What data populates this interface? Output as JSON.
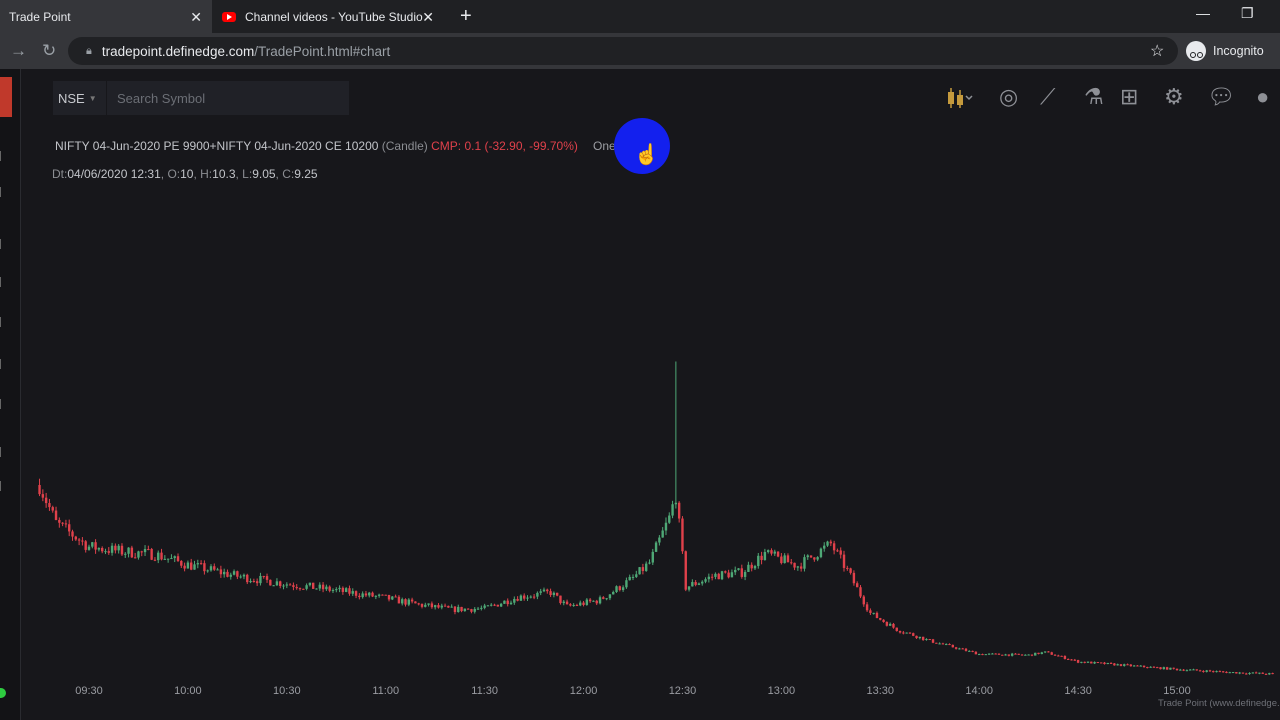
{
  "browser": {
    "tabs": [
      {
        "title": "Trade Point",
        "active": true
      },
      {
        "title": "Channel videos - YouTube Studio",
        "active": false,
        "icon": "youtube-icon"
      }
    ],
    "url_host": "tradepoint.definedge.com",
    "url_path": "/TradePoint.html#chart",
    "profile": "Incognito"
  },
  "app": {
    "exchange": "NSE",
    "search_placeholder": "Search Symbol",
    "toolbar_icons": [
      "candlestick-icon",
      "indicator-icon",
      "drawing-icon",
      "flask-icon",
      "layout-grid-icon",
      "settings-icon",
      "chat-help-icon",
      "user-icon"
    ]
  },
  "chart": {
    "symbol": "NIFTY 04-Jun-2020 PE 9900+NIFTY 04-Jun-2020 CE 10200",
    "chart_type_label": "(Candle)",
    "cmp": "CMP: 0.1 (-32.90, -99.70%)",
    "interval": "One M",
    "ohlc": {
      "dt_label": "Dt:",
      "dt": "04/06/2020 12:31",
      "o_label": "O:",
      "o": "10",
      "h_label": "H:",
      "h": "10.3",
      "l_label": "L:",
      "l": "9.05",
      "c_label": "C:",
      "c": "9.25"
    },
    "credit": "Trade Point (www.definedge.c"
  },
  "colors": {
    "up": "#4ea876",
    "down": "#e0414b",
    "background": "#17171b",
    "cursor_highlight": "#1320ee"
  },
  "chart_data": {
    "type": "candlestick",
    "x_unit": "time (1-minute candles)",
    "x_ticks": [
      "09:30",
      "10:00",
      "10:30",
      "11:00",
      "11:30",
      "12:00",
      "12:30",
      "13:00",
      "13:30",
      "14:00",
      "14:30",
      "15:00"
    ],
    "xlim": [
      "09:15",
      "15:30"
    ],
    "y_axis_shown": false,
    "approx_close_path": [
      {
        "t": "09:15",
        "v": 20
      },
      {
        "t": "09:20",
        "v": 16
      },
      {
        "t": "09:30",
        "v": 13.5
      },
      {
        "t": "09:40",
        "v": 13
      },
      {
        "t": "09:50",
        "v": 12.7
      },
      {
        "t": "10:00",
        "v": 11.6
      },
      {
        "t": "10:15",
        "v": 10.4
      },
      {
        "t": "10:30",
        "v": 9.6
      },
      {
        "t": "10:45",
        "v": 8.9
      },
      {
        "t": "11:00",
        "v": 8.1
      },
      {
        "t": "11:10",
        "v": 7.4
      },
      {
        "t": "11:20",
        "v": 6.9
      },
      {
        "t": "11:30",
        "v": 7.0
      },
      {
        "t": "11:40",
        "v": 8.2
      },
      {
        "t": "11:50",
        "v": 8.7
      },
      {
        "t": "11:55",
        "v": 7.2
      },
      {
        "t": "12:05",
        "v": 7.9
      },
      {
        "t": "12:15",
        "v": 10.2
      },
      {
        "t": "12:20",
        "v": 11.8
      },
      {
        "t": "12:26",
        "v": 16.5
      },
      {
        "t": "12:28",
        "v": 19.0
      },
      {
        "t": "12:31",
        "v": 9.25
      },
      {
        "t": "12:40",
        "v": 10.5
      },
      {
        "t": "12:48",
        "v": 10.8
      },
      {
        "t": "12:55",
        "v": 12.8
      },
      {
        "t": "13:05",
        "v": 11.5
      },
      {
        "t": "13:15",
        "v": 13.8
      },
      {
        "t": "13:20",
        "v": 11.0
      },
      {
        "t": "13:27",
        "v": 6.5
      },
      {
        "t": "13:35",
        "v": 4.8
      },
      {
        "t": "13:45",
        "v": 3.6
      },
      {
        "t": "14:00",
        "v": 2.2
      },
      {
        "t": "14:15",
        "v": 2.1
      },
      {
        "t": "14:20",
        "v": 2.4
      },
      {
        "t": "14:30",
        "v": 1.4
      },
      {
        "t": "14:45",
        "v": 1.0
      },
      {
        "t": "15:00",
        "v": 0.6
      },
      {
        "t": "15:15",
        "v": 0.3
      },
      {
        "t": "15:29",
        "v": 0.1
      }
    ],
    "spike": {
      "t": "12:28",
      "high": 33.0
    }
  }
}
